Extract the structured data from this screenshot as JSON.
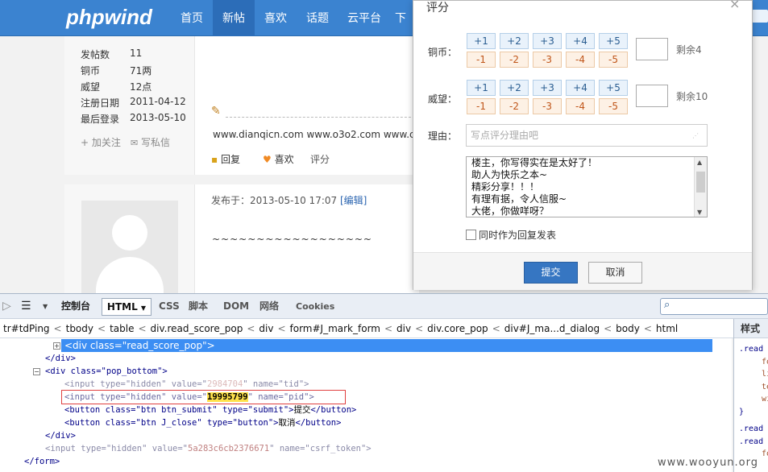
{
  "header": {
    "logo": "phpwind",
    "nav": [
      "首页",
      "新帖",
      "喜欢",
      "话题",
      "云平台",
      "下"
    ]
  },
  "post1": {
    "stats": [
      {
        "label": "发帖数",
        "value": "11"
      },
      {
        "label": "铜币",
        "value": "71两"
      },
      {
        "label": "威望",
        "value": "12点"
      },
      {
        "label": "注册日期",
        "value": "2011-04-12"
      },
      {
        "label": "最后登录",
        "value": "2013-05-10"
      }
    ],
    "follow": "+ 加关注",
    "message": "写私信",
    "links_text": "www.dianqicn.com www.o3o2.com www.cr",
    "reply": "回复",
    "like": "喜欢",
    "rate": "评分"
  },
  "post2": {
    "posted_at": "发布于：2013-05-10 17:07",
    "edit": "[编辑]",
    "body": "~~~~~~~~~~~~~~~~~~"
  },
  "dialog": {
    "title": "评分",
    "close": "×",
    "copper_label": "铜币：",
    "prestige_label": "威望：",
    "plus": [
      "+1",
      "+2",
      "+3",
      "+4",
      "+5"
    ],
    "minus": [
      "-1",
      "-2",
      "-3",
      "-4",
      "-5"
    ],
    "copper_remain": "剩余4",
    "prestige_remain": "剩余10",
    "reason_label": "理由：",
    "reason_placeholder": "写点评分理由吧",
    "reasons": [
      "楼主，你写得实在是太好了！",
      "助人为快乐之本~",
      "精彩分享！！！",
      "有理有据，令人信服~",
      "大佬，你做咩呀？"
    ],
    "also_reply": "同时作为回复发表",
    "submit": "提交",
    "cancel": "取消"
  },
  "firebug": {
    "tabs": [
      "控制台",
      "HTML",
      "CSS",
      "脚本",
      "DOM",
      "网络",
      "Cookies"
    ],
    "breadcrumb": [
      "tr#tdPing",
      "tbody",
      "table",
      "div.read_score_pop",
      "div",
      "form#J_mark_form",
      "div",
      "div.core_pop",
      "div#J_ma...d_dialog",
      "body",
      "html"
    ],
    "styles_tab": "样式",
    "code": {
      "l1": "<div class=\"read_score_pop\">",
      "l2": "</div>",
      "l3": "<div class=\"pop_bottom\">",
      "l4_pre": "<input type=\"hidden\" value=\"",
      "l4_val": "2984704",
      "l4_post": "\" name=\"tid\">",
      "l5_pre": "<input type=\"hidden\" value=\"",
      "l5_val": "19995799",
      "l5_post": "\" name=\"pid\">",
      "l6_pre": "<button class=\"btn btn_submit\" type=\"submit\">",
      "l6_text": "提交",
      "l6_post": "</button>",
      "l7_pre": "<button class=\"btn J_close\" type=\"button\">",
      "l7_text": "取消",
      "l7_post": "</button>",
      "l8": "</div>",
      "l9_pre": "<input type=\"hidden\" value=\"",
      "l9_val": "5a283c6cb2376671",
      "l9_post": "\" name=\"csrf_token\">",
      "l10": "</form>"
    },
    "css_lines": [
      ".read",
      "fo",
      "li",
      "te",
      "wi",
      "}",
      ".read",
      ".read",
      "fo"
    ]
  },
  "watermark": "www.wooyun.org"
}
